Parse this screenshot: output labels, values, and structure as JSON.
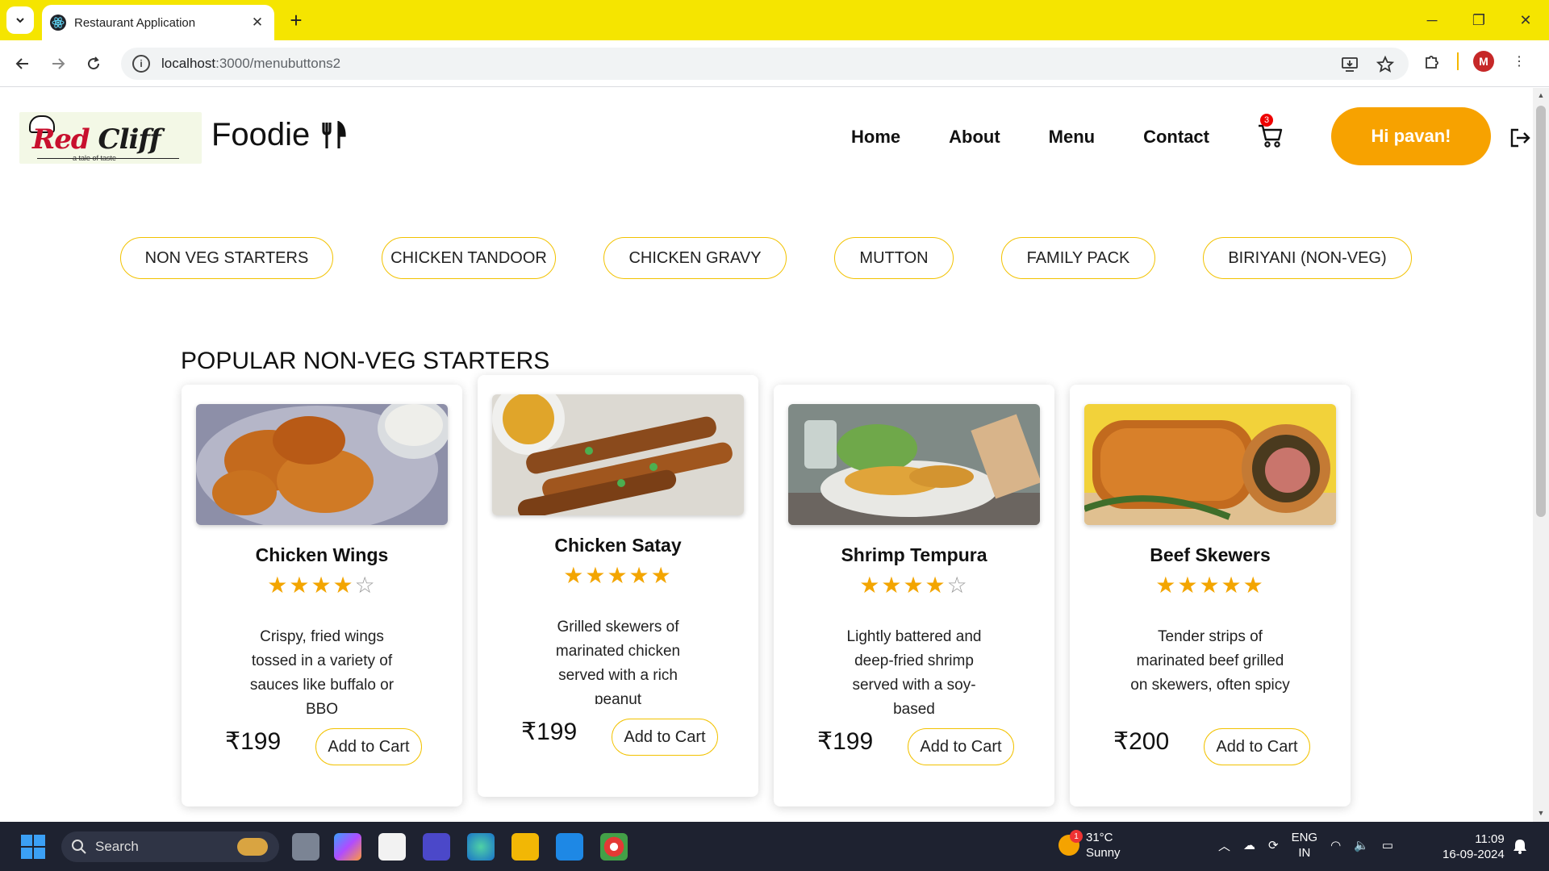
{
  "browser": {
    "tab_title": "Restaurant Application",
    "url_host": "localhost",
    "url_path": ":3000/menubuttons2",
    "profile_initial": "M",
    "window_controls": [
      "minimize-icon",
      "restore-icon",
      "close-icon"
    ]
  },
  "site": {
    "brand": "Foodie",
    "logo_primary": "Red",
    "logo_secondary": "Cliff",
    "logo_tagline": "a tale of taste",
    "nav": [
      "Home",
      "About",
      "Menu",
      "Contact"
    ],
    "cart_count": "3",
    "greeting": "Hi pavan!"
  },
  "categories": [
    "NON VEG STARTERS",
    "CHICKEN TANDOOR",
    "CHICKEN GRAVY",
    "MUTTON",
    "FAMILY PACK",
    "BIRIYANI (NON-VEG)"
  ],
  "section_title": "POPULAR NON-VEG STARTERS",
  "items": [
    {
      "name": "Chicken Wings",
      "rating": 4,
      "description": "Crispy, fried wings tossed in a variety of sauces like buffalo or BBQ",
      "price": "₹199",
      "cta": "Add to Cart"
    },
    {
      "name": "Chicken Satay",
      "rating": 5,
      "description": "Grilled skewers of marinated chicken served with a rich peanut",
      "price": "₹199",
      "cta": "Add to Cart"
    },
    {
      "name": "Shrimp Tempura",
      "rating": 4,
      "description": "Lightly battered and deep-fried shrimp served with a soy-based",
      "price": "₹199",
      "cta": "Add to Cart"
    },
    {
      "name": "Beef Skewers",
      "rating": 5,
      "description": "Tender strips of marinated beef grilled on skewers, often spicy",
      "price": "₹200",
      "cta": "Add to Cart"
    }
  ],
  "taskbar": {
    "search_label": "Search",
    "weather_temp": "31°C",
    "weather_desc": "Sunny",
    "weather_badge": "1",
    "lang_top": "ENG",
    "lang_bottom": "IN",
    "time": "11:09",
    "date": "16-09-2024"
  },
  "colors": {
    "tab_strip": "#f5e500",
    "accent_orange": "#f7a200",
    "pill_border": "#f2c200",
    "star": "#f3a500",
    "taskbar": "#1e2230"
  }
}
